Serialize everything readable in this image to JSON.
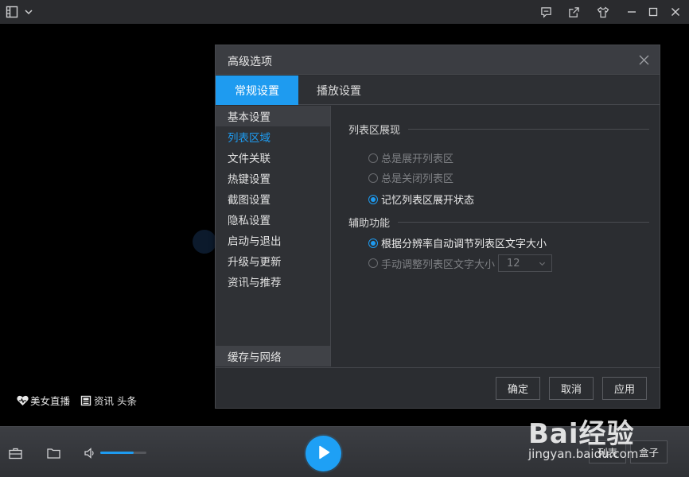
{
  "promo": {
    "live_label": "美女直播",
    "news_label": "资讯 头条"
  },
  "dialog": {
    "title": "高级选项",
    "tabs": [
      {
        "label": "常规设置",
        "active": true
      },
      {
        "label": "播放设置",
        "active": false
      }
    ],
    "nav": [
      {
        "label": "基本设置",
        "state": "hover"
      },
      {
        "label": "列表区域",
        "state": "current"
      },
      {
        "label": "文件关联",
        "state": "normal"
      },
      {
        "label": "热键设置",
        "state": "normal"
      },
      {
        "label": "截图设置",
        "state": "normal"
      },
      {
        "label": "隐私设置",
        "state": "normal"
      },
      {
        "label": "启动与退出",
        "state": "normal"
      },
      {
        "label": "升级与更新",
        "state": "normal"
      },
      {
        "label": "资讯与推荐",
        "state": "normal"
      }
    ],
    "nav_bottom": "缓存与网络",
    "section_list": {
      "title": "列表区展现",
      "options": [
        {
          "label": "总是展开列表区",
          "checked": false
        },
        {
          "label": "总是关闭列表区",
          "checked": false
        },
        {
          "label": "记忆列表区展开状态",
          "checked": true
        }
      ]
    },
    "section_aux": {
      "title": "辅助功能",
      "options": [
        {
          "label": "根据分辨率自动调节列表区文字大小",
          "checked": true
        },
        {
          "label": "手动调整列表区文字大小",
          "checked": false
        }
      ],
      "font_size_value": "12"
    },
    "buttons": {
      "ok": "确定",
      "cancel": "取消",
      "apply": "应用"
    }
  },
  "bottom": {
    "volume_level": 0.72,
    "list_button": "列表",
    "box_button": "盒子"
  },
  "watermark": {
    "logo": "Bai经验",
    "sub": "jingyan.baidu.com"
  },
  "colors": {
    "accent": "#1e9bf0",
    "dialog_bg": "#2b2d31"
  }
}
